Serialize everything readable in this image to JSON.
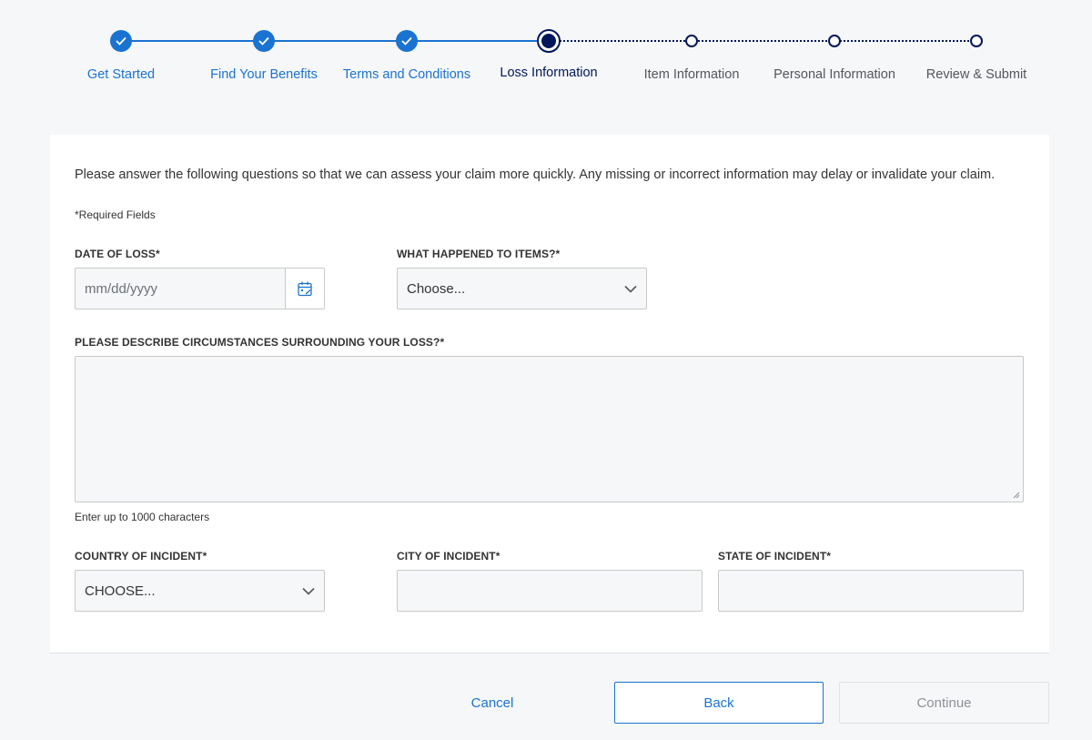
{
  "stepper": {
    "steps": [
      {
        "label": "Get Started",
        "state": "done"
      },
      {
        "label": "Find Your Benefits",
        "state": "done"
      },
      {
        "label": "Terms and Conditions",
        "state": "done"
      },
      {
        "label": "Loss Information",
        "state": "current"
      },
      {
        "label": "Item Information",
        "state": "todo"
      },
      {
        "label": "Personal Information",
        "state": "todo"
      },
      {
        "label": "Review & Submit",
        "state": "todo"
      }
    ]
  },
  "form": {
    "intro": "Please answer the following questions so that we can assess your claim more quickly. Any missing or incorrect information may delay or invalidate your claim.",
    "required_note": "*Required Fields",
    "date_of_loss": {
      "label": "DATE OF LOSS*",
      "placeholder": "mm/dd/yyyy",
      "icon": "calendar-icon"
    },
    "what_happened": {
      "label": "WHAT HAPPENED TO ITEMS?*",
      "value": "Choose..."
    },
    "circumstances": {
      "label": "PLEASE DESCRIBE CIRCUMSTANCES SURROUNDING YOUR LOSS?*",
      "helper": "Enter up to 1000 characters"
    },
    "country": {
      "label": "COUNTRY OF INCIDENT*",
      "value": "CHOOSE..."
    },
    "city": {
      "label": "CITY OF INCIDENT*"
    },
    "state": {
      "label": "STATE OF INCIDENT*"
    }
  },
  "footer": {
    "cancel_label": "Cancel",
    "back_label": "Back",
    "continue_label": "Continue"
  },
  "colors": {
    "accent": "#1a73d1",
    "navy": "#00175a",
    "background": "#f6f7f9"
  }
}
